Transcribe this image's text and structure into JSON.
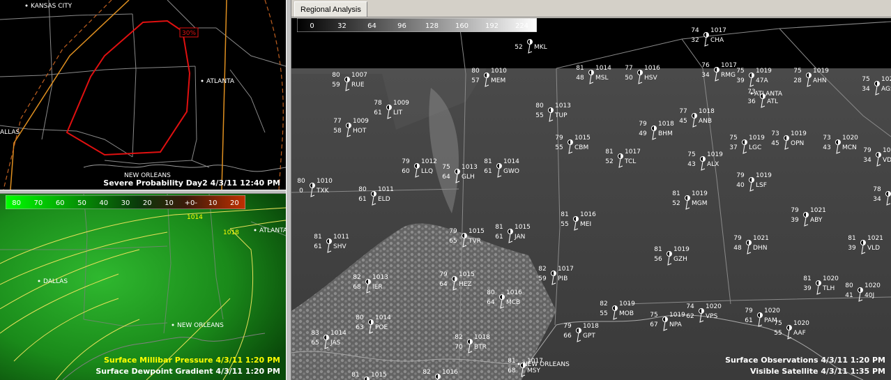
{
  "tabs": [
    {
      "label": "Regional Analysis"
    }
  ],
  "top_left": {
    "footer": "Severe Probability Day2 4/3/11 12:40 PM",
    "prob_label": "30%",
    "cities": [
      {
        "name": "KANSAS CITY"
      },
      {
        "name": "ATLANTA"
      },
      {
        "name": "ALLAS"
      },
      {
        "name": "NEW ORLEANS"
      }
    ]
  },
  "bottom_left": {
    "footer_line1": "Surface Millibar Pressure 4/3/11 1:20 PM",
    "footer_line2": "Surface Dewpoint Gradient 4/3/11 1:20 PM",
    "colorbar_ticks": [
      "80",
      "70",
      "60",
      "50",
      "40",
      "30",
      "20",
      "10",
      "+0-",
      "10",
      "20"
    ],
    "isobar_labels": [
      "1014",
      "1018"
    ],
    "cities": [
      {
        "name": "ATLANTA"
      },
      {
        "name": "DALLAS"
      },
      {
        "name": "NEW ORLEANS"
      }
    ]
  },
  "main": {
    "colorbar_ticks": [
      "0",
      "32",
      "64",
      "96",
      "128",
      "160",
      "192",
      "224"
    ],
    "footer_line1": "Surface Observations 4/3/11 1:20 PM",
    "footer_line2": "Visible Satellite 4/3/11 1:35 PM",
    "cities": [
      {
        "name": "ATLANTA"
      },
      {
        "name": "NEW ORLEANS"
      }
    ],
    "stations": [
      {
        "t": "74",
        "p": "1017",
        "d": "32",
        "id": "CHA"
      },
      {
        "t": "",
        "p": "",
        "d": "52",
        "id": "MKL"
      },
      {
        "t": "75",
        "p": "1019",
        "d": "39",
        "id": "47A"
      },
      {
        "t": "75",
        "p": "1019",
        "d": "28",
        "id": "AHN"
      },
      {
        "t": "76",
        "p": "1017",
        "d": "34",
        "id": "RMG"
      },
      {
        "t": "81",
        "p": "1014",
        "d": "48",
        "id": "MSL"
      },
      {
        "t": "77",
        "p": "1016",
        "d": "50",
        "id": "HSV"
      },
      {
        "t": "80",
        "p": "1010",
        "d": "57",
        "id": "MEM"
      },
      {
        "t": "80",
        "p": "1007",
        "d": "59",
        "id": "RUE"
      },
      {
        "t": "75",
        "p": "1020",
        "d": "34",
        "id": "AGS"
      },
      {
        "t": "73",
        "p": "",
        "d": "36",
        "id": "ATL"
      },
      {
        "t": "78",
        "p": "1009",
        "d": "61",
        "id": "LIT"
      },
      {
        "t": "80",
        "p": "1013",
        "d": "55",
        "id": "TUP"
      },
      {
        "t": "77",
        "p": "1009",
        "d": "58",
        "id": "HOT"
      },
      {
        "t": "77",
        "p": "1018",
        "d": "45",
        "id": "ANB"
      },
      {
        "t": "79",
        "p": "1018",
        "d": "49",
        "id": "BHM"
      },
      {
        "t": "79",
        "p": "1015",
        "d": "55",
        "id": "CBM"
      },
      {
        "t": "75",
        "p": "1019",
        "d": "37",
        "id": "LGC"
      },
      {
        "t": "73",
        "p": "1019",
        "d": "45",
        "id": "OPN"
      },
      {
        "t": "73",
        "p": "1020",
        "d": "43",
        "id": "MCN"
      },
      {
        "t": "79",
        "p": "1021",
        "d": "34",
        "id": "VDI"
      },
      {
        "t": "81",
        "p": "1017",
        "d": "52",
        "id": "TCL"
      },
      {
        "t": "75",
        "p": "1019",
        "d": "43",
        "id": "ALX"
      },
      {
        "t": "79",
        "p": "1012",
        "d": "60",
        "id": "LLQ"
      },
      {
        "t": "75",
        "p": "1013",
        "d": "64",
        "id": "GLH"
      },
      {
        "t": "81",
        "p": "1014",
        "d": "61",
        "id": "GWO"
      },
      {
        "t": "80",
        "p": "1010",
        "d": "0",
        "id": "TXK"
      },
      {
        "t": "80",
        "p": "1011",
        "d": "61",
        "id": "ELD"
      },
      {
        "t": "79",
        "p": "1019",
        "d": "40",
        "id": "LSF"
      },
      {
        "t": "78",
        "p": "1021",
        "d": "34",
        "id": "AMG"
      },
      {
        "t": "81",
        "p": "1019",
        "d": "52",
        "id": "MGM"
      },
      {
        "t": "79",
        "p": "1021",
        "d": "39",
        "id": "ABY"
      },
      {
        "t": "81",
        "p": "1016",
        "d": "55",
        "id": "MEI"
      },
      {
        "t": "79",
        "p": "1015",
        "d": "65",
        "id": "TVR"
      },
      {
        "t": "81",
        "p": "1015",
        "d": "61",
        "id": "JAN"
      },
      {
        "t": "81",
        "p": "1011",
        "d": "61",
        "id": "SHV"
      },
      {
        "t": "79",
        "p": "1021",
        "d": "48",
        "id": "DHN"
      },
      {
        "t": "81",
        "p": "1021",
        "d": "39",
        "id": "VLD"
      },
      {
        "t": "81",
        "p": "1019",
        "d": "56",
        "id": "GZH"
      },
      {
        "t": "82",
        "p": "1017",
        "d": "59",
        "id": "PIB"
      },
      {
        "t": "82",
        "p": "1013",
        "d": "68",
        "id": "IER"
      },
      {
        "t": "79",
        "p": "1015",
        "d": "64",
        "id": "HEZ"
      },
      {
        "t": "81",
        "p": "1020",
        "d": "39",
        "id": "TLH"
      },
      {
        "t": "80",
        "p": "1020",
        "d": "41",
        "id": "40J"
      },
      {
        "t": "80",
        "p": "1016",
        "d": "64",
        "id": "MCB"
      },
      {
        "t": "82",
        "p": "1019",
        "d": "55",
        "id": "MOB"
      },
      {
        "t": "74",
        "p": "1020",
        "d": "62",
        "id": "VPS"
      },
      {
        "t": "75",
        "p": "1019",
        "d": "67",
        "id": "NPA"
      },
      {
        "t": "79",
        "p": "1020",
        "d": "61",
        "id": "PAM"
      },
      {
        "t": "75",
        "p": "1020",
        "d": "55",
        "id": "AAF"
      },
      {
        "t": "80",
        "p": "1014",
        "d": "63",
        "id": "POE"
      },
      {
        "t": "79",
        "p": "1018",
        "d": "66",
        "id": "GPT"
      },
      {
        "t": "83",
        "p": "1014",
        "d": "65",
        "id": "JAS"
      },
      {
        "t": "82",
        "p": "1018",
        "d": "70",
        "id": "BTR"
      },
      {
        "t": "81",
        "p": "1017",
        "d": "68",
        "id": "MSY"
      },
      {
        "t": "81",
        "p": "1015",
        "d": "",
        "id": ""
      },
      {
        "t": "82",
        "p": "1016",
        "d": "",
        "id": ""
      }
    ]
  }
}
